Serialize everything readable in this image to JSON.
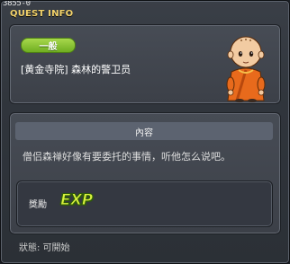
{
  "window": {
    "quest_id": "3855-0",
    "title": "QUEST INFO",
    "close_glyph": "×"
  },
  "quest": {
    "category_badge": "一般",
    "name": "[黄金寺院] 森林的警卫员",
    "npc_icon": "monk-npc-portrait"
  },
  "content": {
    "header": "內容",
    "text": "僧侣森禅好像有要委托的事情，听他怎么说吧。"
  },
  "reward": {
    "label": "獎勵",
    "exp_icon_text": "EXP"
  },
  "status": {
    "text": "狀態:  可開始"
  },
  "colors": {
    "title": "#f3d36b",
    "badge": "#8cc63a",
    "exp": "#d8f23c"
  }
}
